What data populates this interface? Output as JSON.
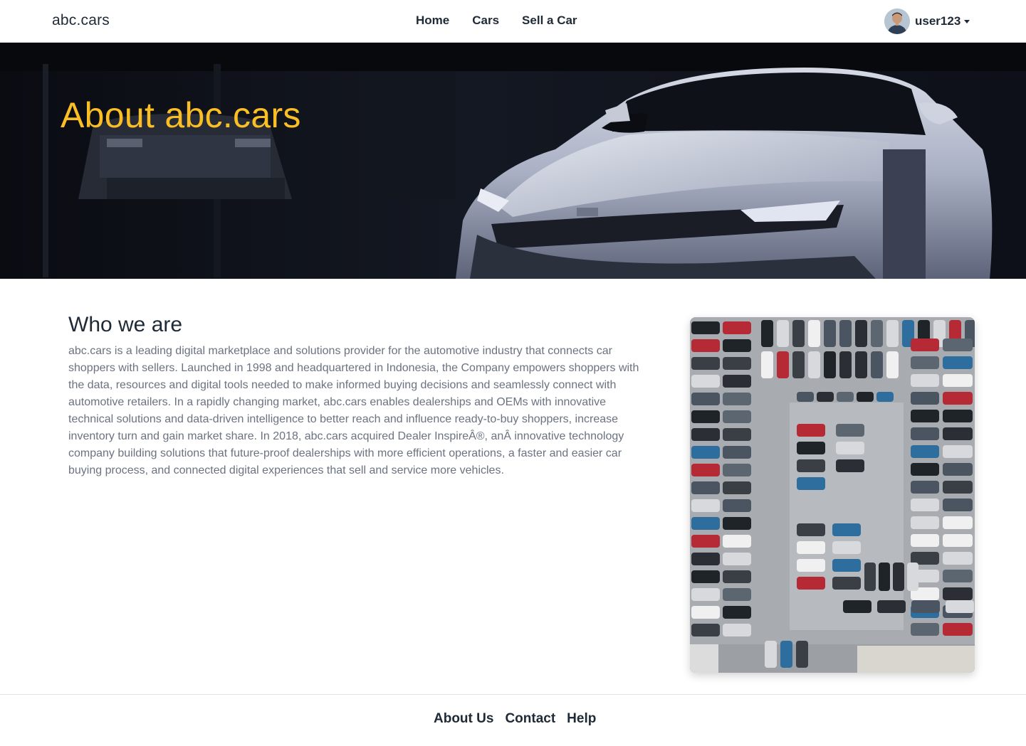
{
  "navbar": {
    "brand": "abc.cars",
    "links": [
      "Home",
      "Cars",
      "Sell a Car"
    ],
    "user": {
      "name": "user123",
      "avatar_icon": "user-avatar-icon"
    }
  },
  "hero": {
    "title": "About abc.cars",
    "title_color": "#fbbf24",
    "image": "sports-car-photo"
  },
  "about": {
    "heading": "Who we are",
    "body": "abc.cars is a leading digital marketplace and solutions provider for the automotive industry that connects car shoppers with sellers. Launched in 1998 and headquartered in Indonesia, the Company empowers shoppers with the data, resources and digital tools needed to make informed buying decisions and seamlessly connect with automotive retailers. In a rapidly changing market, abc.cars enables dealerships and OEMs with innovative technical solutions and data-driven intelligence to better reach and influence ready-to-buy shoppers, increase inventory turn and gain market share. In 2018, abc.cars acquired Dealer InspireÂ®, anÂ innovative technology company building solutions that future-proof dealerships with more efficient operations, a faster and easier car buying process, and connected digital experiences that sell and service more vehicles.",
    "image": "parking-lot-aerial-photo"
  },
  "footer": {
    "links": [
      "About Us",
      "Contact",
      "Help"
    ]
  }
}
